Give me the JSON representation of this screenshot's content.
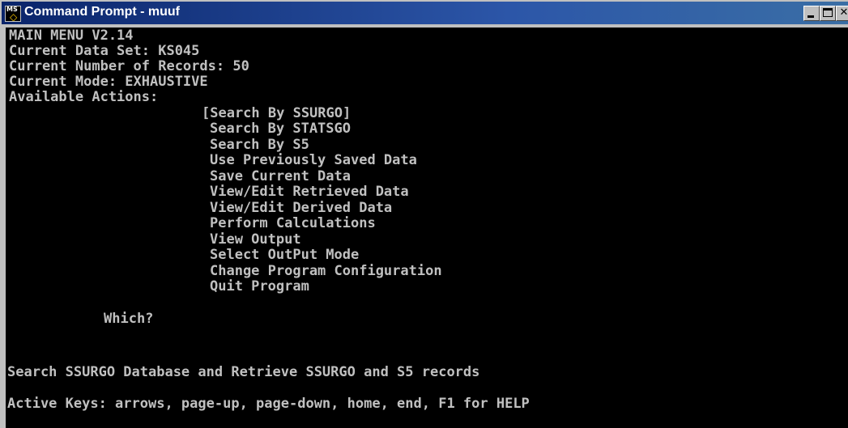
{
  "window": {
    "title": "Command Prompt - muuf",
    "icon": "ms-dos-icon",
    "controls": [
      "minimize",
      "maximize",
      "close"
    ]
  },
  "console": {
    "header": [
      "MAIN MENU V2.14",
      "Current Data Set: KS045",
      "Current Number of Records: 50",
      "Current Mode: EXHAUSTIVE",
      "Available Actions:"
    ],
    "menu_items": [
      "[Search By SSURGO]",
      "Search By STATSGO",
      "Search By S5",
      "Use Previously Saved Data",
      "Save Current Data",
      "View/Edit Retrieved Data",
      "View/Edit Derived Data",
      "Perform Calculations",
      "View Output",
      "Select OutPut Mode",
      "Change Program Configuration",
      "Quit Program"
    ],
    "prompt": "Which?",
    "description": "Search SSURGO Database and Retrieve SSURGO and S5 records",
    "active_keys": "Active Keys: arrows, page-up, page-down, home, end, F1 for HELP"
  },
  "colors": {
    "console_bg": "#000000",
    "console_text": "#c0c0c0",
    "title_bar": "#0a246a"
  }
}
